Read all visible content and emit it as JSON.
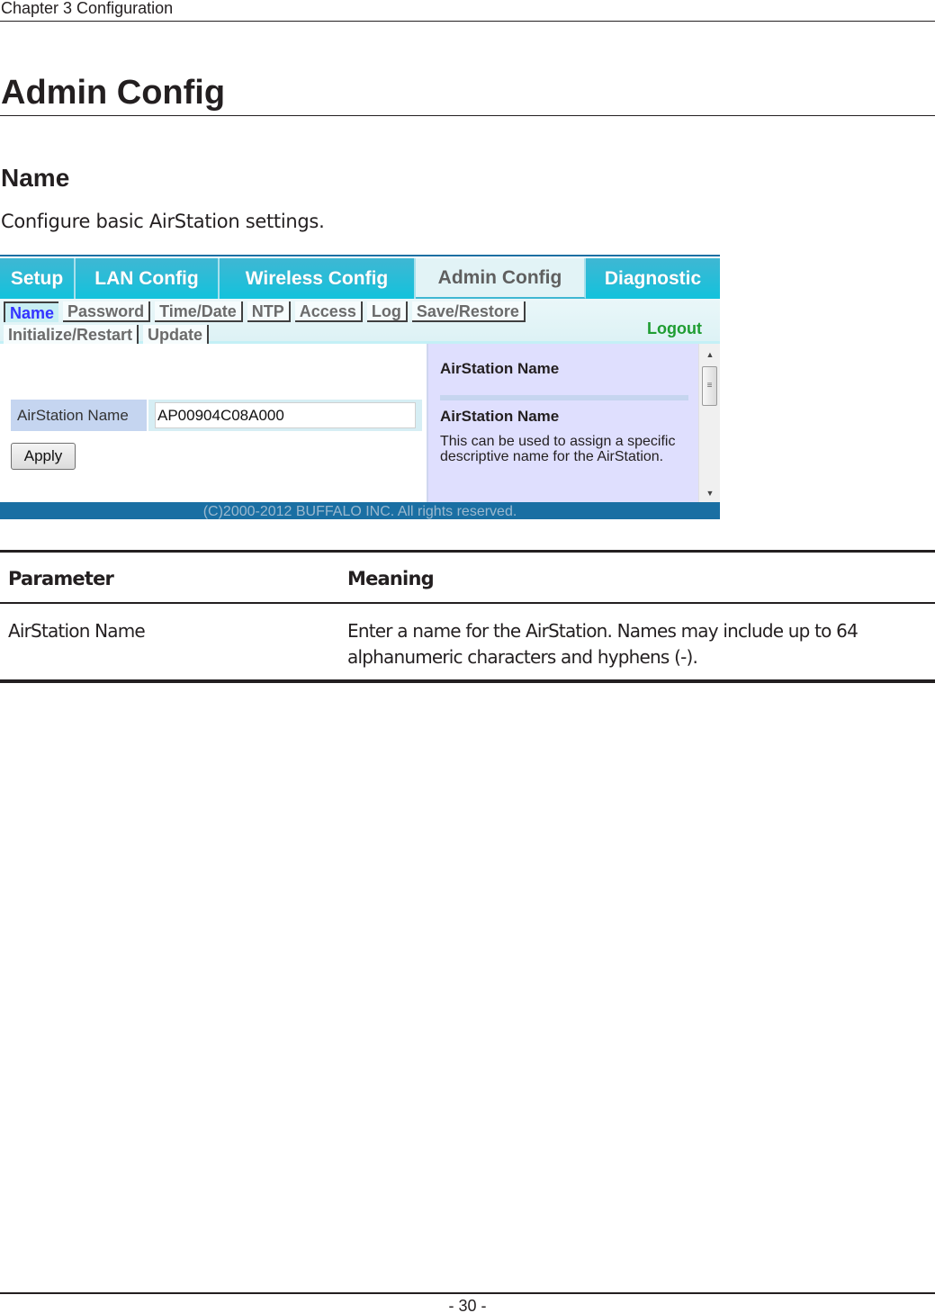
{
  "document": {
    "chapter_header": "Chapter 3  Configuration",
    "page_title": "Admin Config",
    "section_title": "Name",
    "section_description": "Configure basic AirStation settings.",
    "page_number": "- 30 -"
  },
  "screenshot": {
    "main_tabs": [
      {
        "label": "Setup",
        "active": false
      },
      {
        "label": "LAN Config",
        "active": false
      },
      {
        "label": "Wireless Config",
        "active": false
      },
      {
        "label": "Admin Config",
        "active": true
      },
      {
        "label": "Diagnostic",
        "active": false
      }
    ],
    "sub_tabs_row1": [
      {
        "label": "Name",
        "active": true
      },
      {
        "label": "Password",
        "active": false
      },
      {
        "label": "Time/Date",
        "active": false
      },
      {
        "label": "NTP",
        "active": false
      },
      {
        "label": "Access",
        "active": false
      },
      {
        "label": "Log",
        "active": false
      },
      {
        "label": "Save/Restore",
        "active": false
      }
    ],
    "sub_tabs_row2": [
      {
        "label": "Initialize/Restart",
        "active": false
      },
      {
        "label": "Update",
        "active": false
      }
    ],
    "logout_label": "Logout",
    "form": {
      "field_label": "AirStation Name",
      "field_value": "AP00904C08A000",
      "apply_label": "Apply"
    },
    "help": {
      "title": "AirStation Name",
      "subtitle": "AirStation Name",
      "text": "This can be used to assign a specific descriptive name for the AirStation."
    },
    "scrollbar": {
      "up_icon": "▲",
      "down_icon": "▼",
      "grip_icon": "≡"
    },
    "footer": "(C)2000-2012 BUFFALO INC. All rights reserved.",
    "colors": {
      "tab_bar": "#13c2dc",
      "active_tab": "#e2f3f6",
      "active_subtab_text": "#3333ff",
      "logout": "#1f9d32",
      "help_panel": "#dfdffe",
      "footer_bar": "#1a6fa3"
    }
  },
  "table": {
    "headers": [
      "Parameter",
      "Meaning"
    ],
    "rows": [
      {
        "parameter": "AirStation Name",
        "meaning": "Enter a name for the AirStation. Names may include up to 64 alphanumeric characters and hyphens (-)."
      }
    ]
  }
}
